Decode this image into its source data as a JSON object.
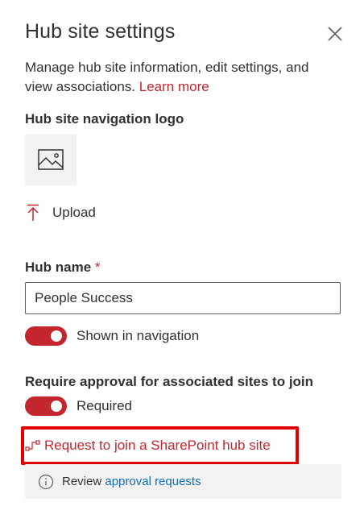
{
  "panel": {
    "title": "Hub site settings",
    "description": "Manage hub site information, edit settings, and view associations.",
    "learn_more": "Learn more"
  },
  "logo": {
    "label": "Hub site navigation logo",
    "placeholder_icon": "image-icon",
    "upload_label": "Upload",
    "upload_icon": "upload-icon"
  },
  "hub_name": {
    "label": "Hub name",
    "required_marker": "*",
    "value": "People Success"
  },
  "nav_toggle": {
    "label": "Shown in navigation",
    "on": true
  },
  "approval": {
    "label": "Require approval for associated sites to join",
    "toggle_label": "Required",
    "on": true,
    "request_link": "Request to join a SharePoint hub site",
    "request_icon": "flow-icon"
  },
  "info": {
    "icon": "info-icon",
    "prefix": "Review",
    "link": "approval requests"
  },
  "colors": {
    "accent": "#c4262e",
    "link_blue": "#0f6cbd",
    "highlight": "#e00000"
  }
}
